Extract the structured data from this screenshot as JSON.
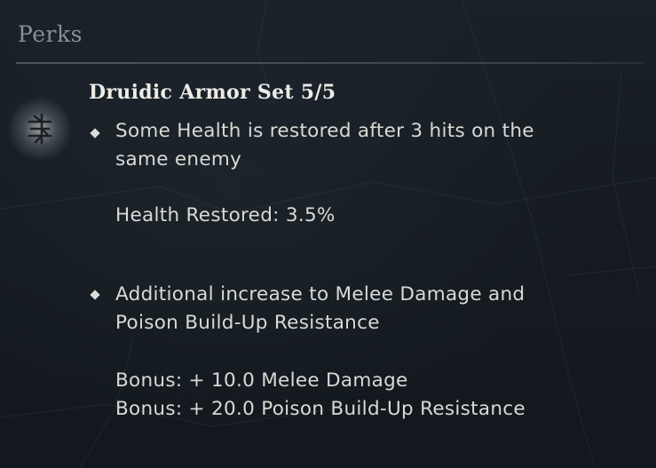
{
  "section": {
    "title": "Perks"
  },
  "perk": {
    "icon": "druidic-rune-icon",
    "name": "Druidic Armor Set 5/5",
    "effects": [
      {
        "line1": "Some Health is restored after 3 hits on the",
        "line2": "same enemy",
        "stats": [
          "Health Restored: 3.5%"
        ]
      },
      {
        "line1": "Additional increase to Melee Damage and",
        "line2": "Poison Build-Up Resistance",
        "stats": [
          "Bonus: + 10.0 Melee Damage",
          "Bonus: + 20.0 Poison Build-Up Resistance"
        ]
      }
    ]
  },
  "colors": {
    "background": "#151b21",
    "title": "#8a8f92",
    "text": "#d9d9d5",
    "heading": "#ecebe6"
  }
}
